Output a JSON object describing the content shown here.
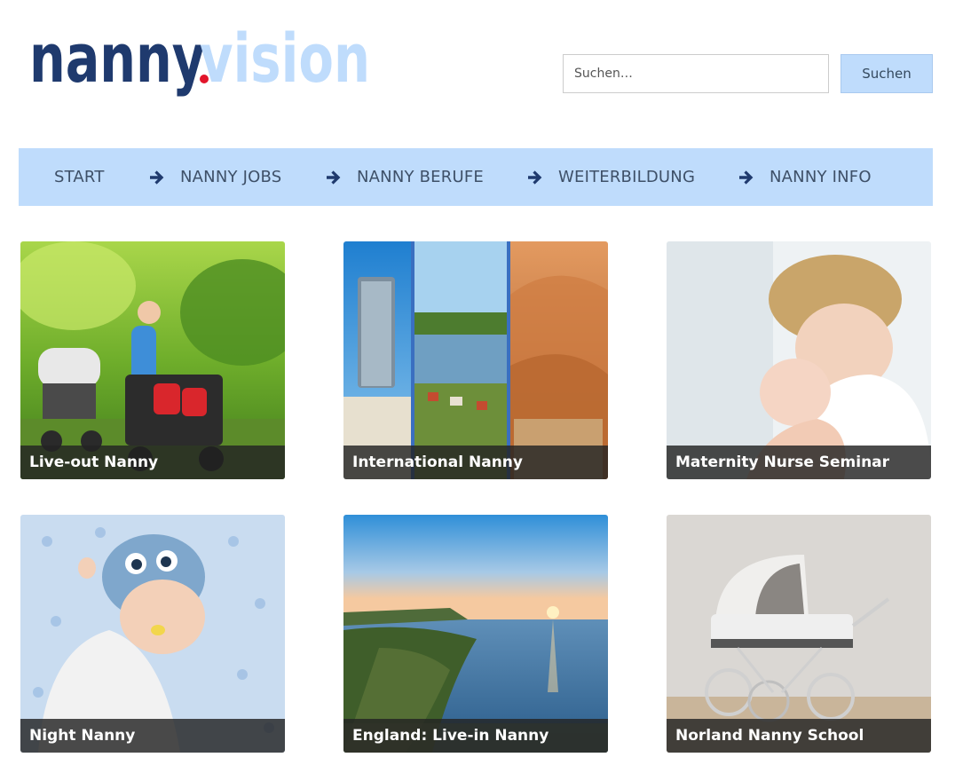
{
  "brand": {
    "part1": "nanny",
    "part2": "vision",
    "colors": {
      "dark": "#1f3a6e",
      "light": "#bfdcfc",
      "dot": "#e2152b"
    }
  },
  "search": {
    "placeholder": "Suchen…",
    "button_label": "Suchen"
  },
  "nav": {
    "background": "#bfdcfc",
    "items": [
      {
        "label": "START",
        "arrow": false
      },
      {
        "label": "NANNY JOBS",
        "arrow": true,
        "icon": "arrow-right-icon"
      },
      {
        "label": "NANNY BERUFE",
        "arrow": true,
        "icon": "arrow-right-icon"
      },
      {
        "label": "WEITERBILDUNG",
        "arrow": true,
        "icon": "arrow-right-icon"
      },
      {
        "label": "NANNY INFO",
        "arrow": true,
        "icon": "arrow-right-icon"
      }
    ]
  },
  "cards": [
    {
      "title": "Live-out Nanny",
      "image": "mother-stroller-park-photo"
    },
    {
      "title": "International Nanny",
      "image": "city-lake-desert-collage-photo"
    },
    {
      "title": "Maternity Nurse Seminar",
      "image": "mother-newborn-photo"
    },
    {
      "title": "Night Nanny",
      "image": "sleeping-baby-owl-hat-photo"
    },
    {
      "title": "England: Live-in Nanny",
      "image": "coast-sunset-photo"
    },
    {
      "title": "Norland Nanny School",
      "image": "vintage-pram-photo"
    }
  ]
}
